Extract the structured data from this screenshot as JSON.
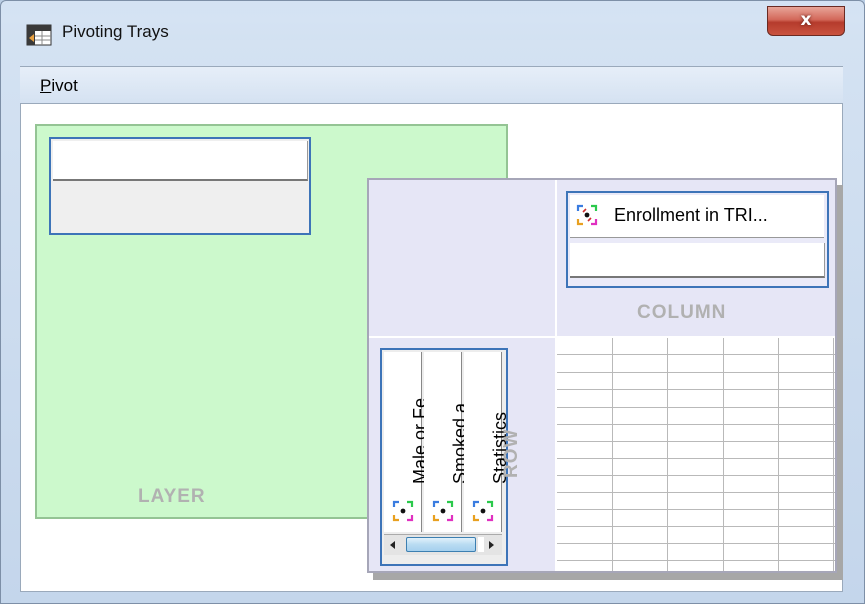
{
  "window": {
    "title": "Pivoting Trays",
    "close_label": "x"
  },
  "menu": {
    "pivot_label_mnemonic": "P",
    "pivot_label_rest": "ivot"
  },
  "trays": {
    "layer": {
      "label": "LAYER"
    },
    "column": {
      "label": "COLUMN",
      "items": [
        {
          "label": "Enrollment in TRI...",
          "icon": "pivot-dimension-icon"
        }
      ]
    },
    "row": {
      "label": "ROW",
      "items": [
        {
          "label": "Male or Fe...",
          "icon": "pivot-dimension-icon"
        },
        {
          "label": "Smoked a...",
          "icon": "pivot-dimension-icon"
        },
        {
          "label": "Statistics",
          "icon": "pivot-dimension-icon"
        }
      ]
    }
  },
  "colors": {
    "layer_tray": "#ccf9cc",
    "pivot_panel": "#e6e6f6",
    "slot_border": "#3d74b8",
    "tray_label": "#b1b1b1",
    "close_button": "#c9533f"
  }
}
